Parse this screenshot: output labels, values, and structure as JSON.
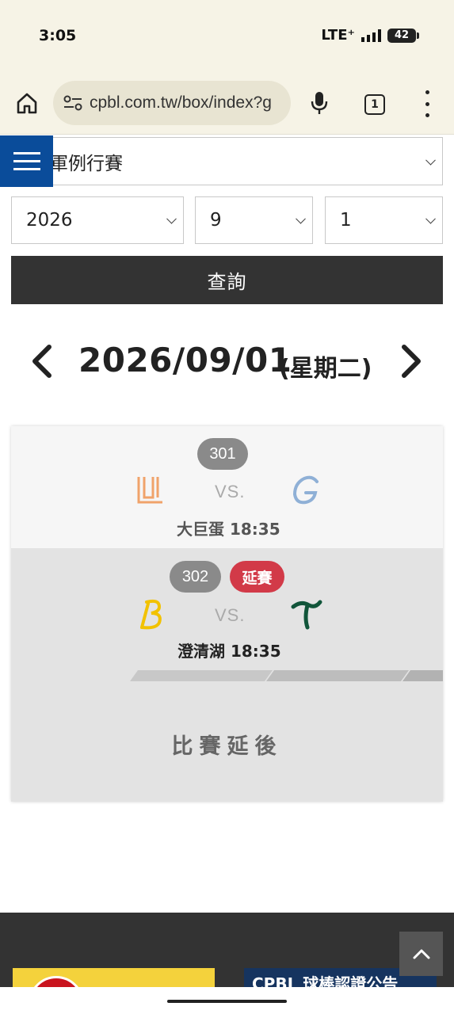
{
  "status_bar": {
    "time": "3:05",
    "network": "LTE⁺",
    "battery": "42"
  },
  "browser": {
    "url": "cpbl.com.tw/box/index?g",
    "tab_count": "1"
  },
  "filters": {
    "game_type": "軍例行賽",
    "year": "2026",
    "month": "9",
    "day": "1",
    "query_label": "查詢"
  },
  "date_nav": {
    "date": "2026/09/01",
    "weekday": "(星期二)"
  },
  "games": [
    {
      "number": "301",
      "away_logo": "ul-logo",
      "home_logo": "g-logo",
      "vs": "VS.",
      "venue_time": "大巨蛋 18:35"
    },
    {
      "number": "302",
      "badge": "延賽",
      "away_logo": "b-logo",
      "home_logo": "t-logo",
      "vs": "VS.",
      "venue_time": "澄清湖 18:35",
      "status": "比賽延後"
    }
  ],
  "footer": {
    "banner_right": "CPBL 球棒認證公告"
  },
  "colors": {
    "header_blue": "#0a4c9a",
    "delay_red": "#d23a48",
    "query_bg": "#333333"
  }
}
